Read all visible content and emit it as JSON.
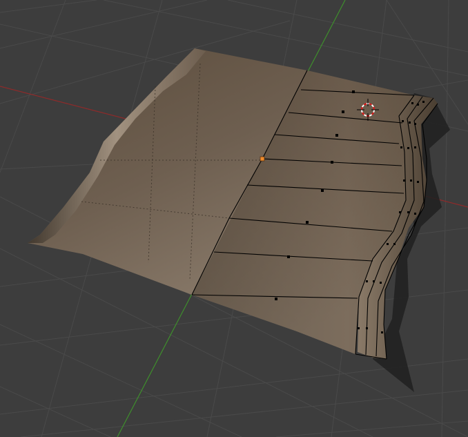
{
  "viewport": {
    "background_color": "#3d3d3d",
    "grid_color": "#484848",
    "x_axis_color": "#8f2a2a",
    "y_axis_color": "#3e8f2c"
  },
  "mesh": {
    "surface_color": "#6e5f50",
    "wire_color": "#000000",
    "vertex_color": "#000000",
    "active_vertex_color": "#f08b2c",
    "shading": "smooth"
  },
  "cursor_3d": {
    "icon": "3d-cursor-icon",
    "ring_colors": [
      "#ffffff",
      "#e01818"
    ]
  }
}
